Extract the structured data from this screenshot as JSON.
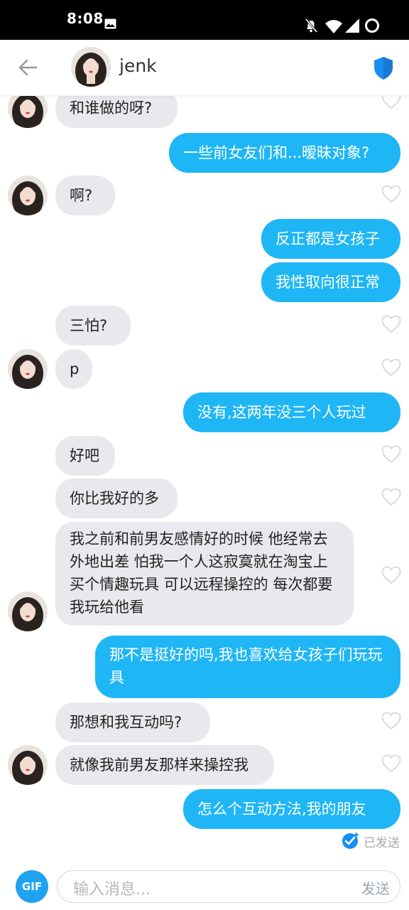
{
  "status_bar": {
    "time": "8:08"
  },
  "header": {
    "contact_name": "jenk"
  },
  "colors": {
    "outgoing": "#1fb6f5",
    "incoming": "#e9e9ed",
    "accent": "#1a8ef0"
  },
  "messages": [
    {
      "dir": "in",
      "text": "和谁做的呀?",
      "avatar": true
    },
    {
      "dir": "out",
      "text": "一些前女友们和...暧昧对象?"
    },
    {
      "dir": "in",
      "text": "啊?",
      "avatar": true
    },
    {
      "dir": "out",
      "text": "反正都是女孩子"
    },
    {
      "dir": "out",
      "text": "我性取向很正常"
    },
    {
      "dir": "in",
      "text": "三怕?",
      "avatar": false
    },
    {
      "dir": "in",
      "text": "p",
      "avatar": true
    },
    {
      "dir": "out",
      "text": "没有,这两年没三个人玩过"
    },
    {
      "dir": "in",
      "text": "好吧",
      "avatar": false
    },
    {
      "dir": "in",
      "text": "你比我好的多",
      "avatar": false
    },
    {
      "dir": "in",
      "text": "我之前和前男友感情好的时候 他经常去外地出差 怕我一个人这寂寞就在淘宝上买个情趣玩具  可以远程操控的 每次都要我玩给他看",
      "avatar": true
    },
    {
      "dir": "out",
      "text": "那不是挺好的吗,我也喜欢给女孩子们玩玩具"
    },
    {
      "dir": "in",
      "text": "那想和我互动吗?",
      "avatar": false
    },
    {
      "dir": "in",
      "text": "就像我前男友那样来操控我",
      "avatar": true
    },
    {
      "dir": "out",
      "text": "怎么个互动方法,我的朋友"
    }
  ],
  "sent_status": "已发送",
  "input": {
    "gif_label": "GIF",
    "placeholder": "输入消息...",
    "send_label": "发送"
  }
}
